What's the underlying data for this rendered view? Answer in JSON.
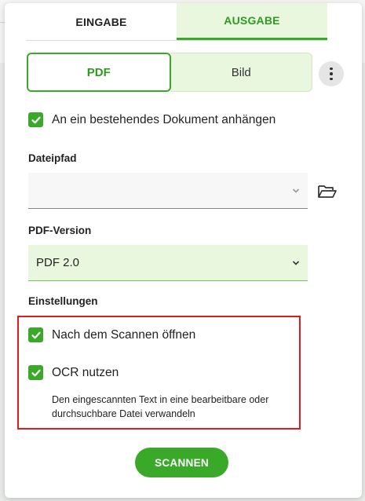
{
  "tabs": {
    "input": "EINGABE",
    "output": "AUSGABE",
    "active": "output"
  },
  "format": {
    "options": [
      "PDF",
      "Bild"
    ],
    "selected": "PDF"
  },
  "more_icon": "more-vertical-icon",
  "append": {
    "label": "An ein bestehendes Dokument anhängen",
    "checked": true
  },
  "path": {
    "label": "Dateipfad",
    "value": "",
    "folder_icon": "folder-open-icon"
  },
  "version": {
    "label": "PDF-Version",
    "value": "PDF 2.0"
  },
  "settings": {
    "label": "Einstellungen",
    "open_after_scan": {
      "label": "Nach dem Scannen öffnen",
      "checked": true
    },
    "ocr": {
      "label": "OCR nutzen",
      "checked": true,
      "description": "Den eingescannten Text in eine bearbeitbare oder durchsuchbare Datei verwandeln"
    }
  },
  "scan_button": "SCANNEN",
  "colors": {
    "accent": "#3aa92a",
    "accent_light": "#e9f7df",
    "highlight": "#e01b1b"
  }
}
